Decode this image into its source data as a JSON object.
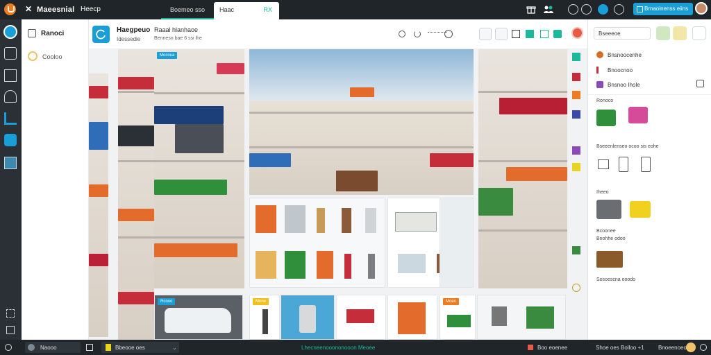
{
  "app": {
    "title": "Maeesnial",
    "menu": "Heecp"
  },
  "tabs": [
    {
      "label": "Boemeo sso"
    },
    {
      "label": "Haac",
      "close": "RX"
    }
  ],
  "topbar": {
    "primary_button": "Brnaoinenss eiins"
  },
  "nav": {
    "group": "Ranoci",
    "item": "Cooloo"
  },
  "header": {
    "title": "Haegpeuo",
    "subtitle": "Idessedie",
    "section_title": "Raaal hlanhaoe",
    "section_subtitle": "Bennesn bae 6 ssi lhe"
  },
  "canvas": {
    "tile_badges": [
      "Mocoua",
      "Rcooo",
      "Mnne",
      "Moeo"
    ],
    "colors": {
      "accent": "#1cb89a",
      "blue": "#1a9ed8",
      "orange": "#f07a1e",
      "topbar": "#1f2528"
    }
  },
  "rpanel": {
    "dropdown": "Bseeeoe",
    "layers": [
      "Bnsnoocenhe",
      "Bnoocnoo",
      "Bnsnoo Ihole"
    ],
    "section1": "Ronoco",
    "caption1": "Bseeenlenseo ocoo sis eohe",
    "section2": "Iheeo",
    "caption2": "Bcoonee",
    "caption3": "Bnohhe odoo",
    "caption4": "Sosoescna ooodo"
  },
  "status": {
    "left_label": "Naooo",
    "file_label": "Bbeooe oes",
    "center": "Lhecneenooononooon Meoee",
    "right1": "Boo eoenee",
    "right2": "Shoe oes Bolloo +1",
    "right3": "Bnoeenoeoos"
  }
}
